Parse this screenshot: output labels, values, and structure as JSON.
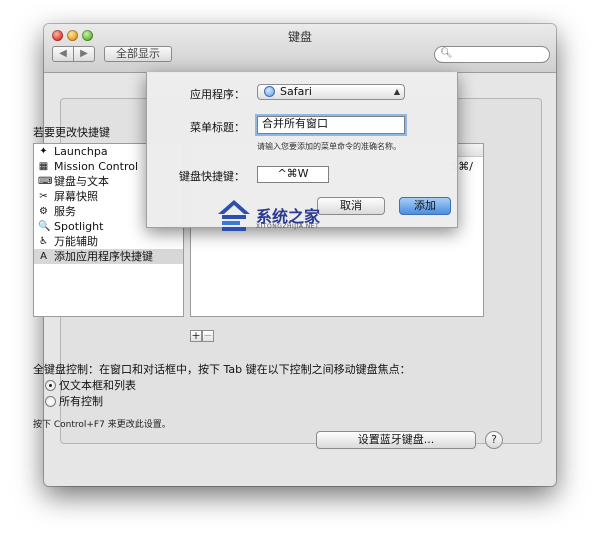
{
  "window": {
    "title": "键盘"
  },
  "toolbar": {
    "back": "◀",
    "forward": "▶",
    "show_all": "全部显示",
    "search_placeholder": ""
  },
  "shortcuts_label": "若要更改快捷键",
  "categories": [
    {
      "label": "Launchpa",
      "icon": "launchpad-icon",
      "glyph": "✦"
    },
    {
      "label": "Mission Control",
      "icon": "mission-control-icon",
      "glyph": "▦"
    },
    {
      "label": "键盘与文本",
      "icon": "keyboard-icon",
      "glyph": "⌨"
    },
    {
      "label": "屏幕快照",
      "icon": "screenshot-icon",
      "glyph": "✂"
    },
    {
      "label": "服务",
      "icon": "services-gear-icon",
      "glyph": "⚙"
    },
    {
      "label": "Spotlight",
      "icon": "spotlight-icon",
      "glyph": "🔍"
    },
    {
      "label": "万能辅助",
      "icon": "accessibility-icon",
      "glyph": "♿"
    },
    {
      "label": "添加应用程序快捷键",
      "icon": "app-shortcuts-icon",
      "glyph": "A"
    }
  ],
  "selected_category_index": 7,
  "right_pane": {
    "shortcut": "⇧⌘/"
  },
  "list_buttons": {
    "add": "+",
    "remove": "−"
  },
  "keyboard_control": {
    "label": "全键盘控制：在窗口和对话框中，按下 Tab 键在以下控制之间移动键盘焦点：",
    "options": [
      "仅文本框和列表",
      "所有控制"
    ],
    "selected": 0,
    "hint": "按下 Control+F7 来更改此设置。"
  },
  "bluetooth_button": "设置蓝牙键盘...",
  "help_button": "?",
  "sheet": {
    "app_label": "应用程序：",
    "app_value": "Safari",
    "menu_title_label": "菜单标题：",
    "menu_title_value": "合并所有窗口",
    "menu_hint": "请输入您要添加的菜单命令的准确名称。",
    "shortcut_label": "键盘快捷键：",
    "shortcut_value": "^⌘W",
    "cancel": "取消",
    "add": "添加"
  },
  "watermark": {
    "title": "系统之家",
    "subtitle": "XITONGZHIJIA.NET"
  }
}
